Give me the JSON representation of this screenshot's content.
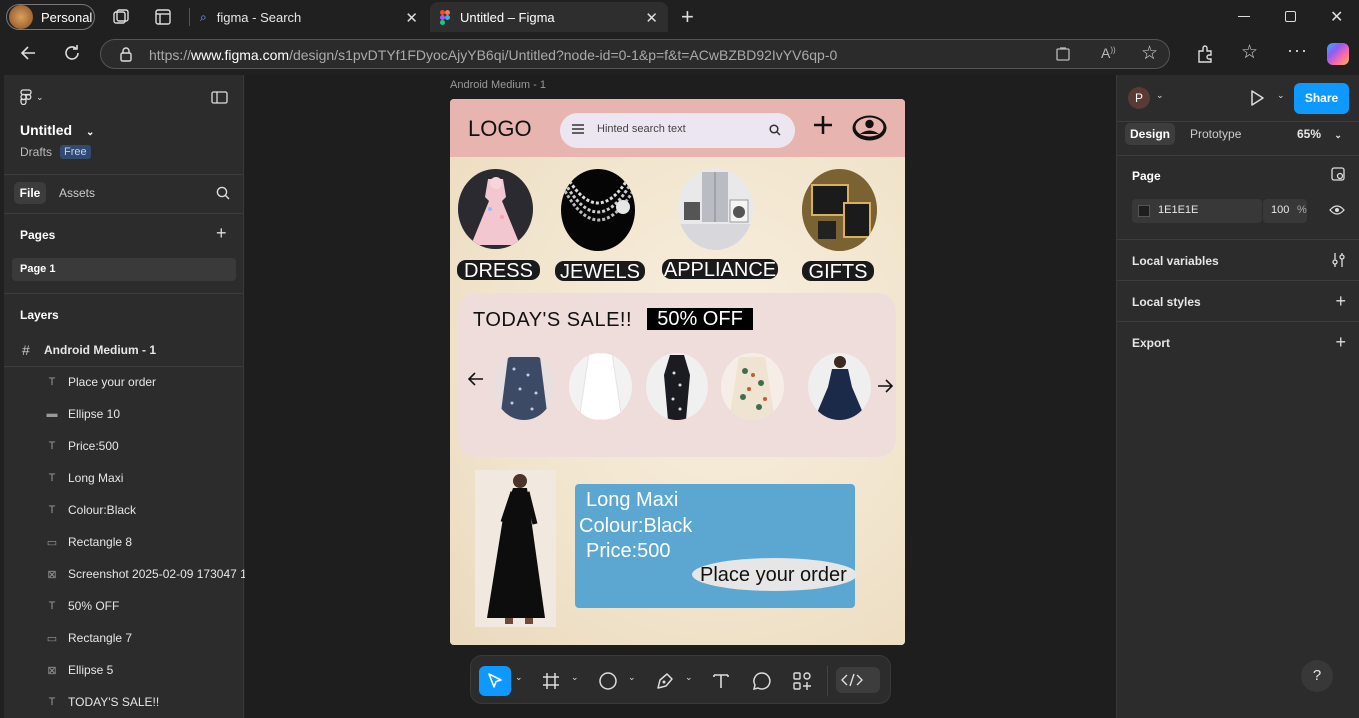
{
  "browser": {
    "profile_label": "Personal",
    "tabs": [
      {
        "label": "figma - Search"
      },
      {
        "label": "Untitled – Figma"
      }
    ],
    "url_prefix": "https://",
    "url_domain": "www.figma.com",
    "url_rest": "/design/s1pvDTYf1FDyocAjyYB6qi/Untitled?node-id=0-1&p=f&t=ACwBZBD92IvYV6qp-0"
  },
  "left_panel": {
    "file_title": "Untitled",
    "drafts_label": "Drafts",
    "plan_badge": "Free",
    "tab_file": "File",
    "tab_assets": "Assets",
    "pages_heading": "Pages",
    "pages": [
      "Page 1"
    ],
    "layers_heading": "Layers",
    "frame_layer": "Android Medium - 1",
    "layers": [
      {
        "icon": "text-icon",
        "label": "Place your order"
      },
      {
        "icon": "ellipse-icon",
        "label": "Ellipse 10"
      },
      {
        "icon": "text-icon",
        "label": "Price:500"
      },
      {
        "icon": "text-icon",
        "label": "Long Maxi"
      },
      {
        "icon": "text-icon",
        "label": "Colour:Black"
      },
      {
        "icon": "rectangle-icon",
        "label": "Rectangle 8"
      },
      {
        "icon": "image-icon",
        "label": "Screenshot 2025-02-09 173047 1"
      },
      {
        "icon": "text-icon",
        "label": "50% OFF"
      },
      {
        "icon": "rectangle-icon",
        "label": "Rectangle 7"
      },
      {
        "icon": "image-icon",
        "label": "Ellipse 5"
      },
      {
        "icon": "text-icon",
        "label": "TODAY'S SALE!!"
      }
    ]
  },
  "canvas": {
    "frame_label": "Android Medium - 1",
    "design": {
      "logo": "LOGO",
      "search_placeholder": "Hinted search text",
      "categories": [
        "DRESS",
        "JEWELS",
        "APPLIANCE",
        "GIFTS"
      ],
      "sale_title": "TODAY'S SALE!!",
      "discount": "50% OFF",
      "product_name": "Long Maxi",
      "product_colour": "Colour:Black",
      "product_price": "Price:500",
      "order_button": "Place your order"
    }
  },
  "right_panel": {
    "avatar_letter": "P",
    "share_label": "Share",
    "tab_design": "Design",
    "tab_prototype": "Prototype",
    "zoom": "65%",
    "page_heading": "Page",
    "bg_color_hex": "1E1E1E",
    "bg_opacity": "100",
    "percent_sign": "%",
    "local_variables": "Local variables",
    "local_styles": "Local styles",
    "export": "Export"
  },
  "colors": {
    "accent": "#0d99ff",
    "header_pink": "#e8b4b0",
    "product_card": "#5ba7d1",
    "sale_panel": "#efdddc"
  },
  "help_label": "?"
}
